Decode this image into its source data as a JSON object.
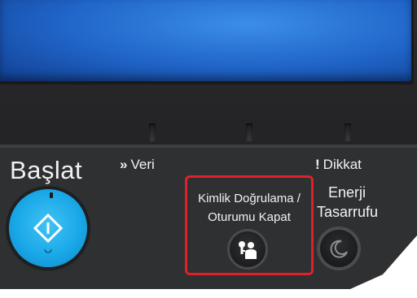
{
  "panel": {
    "start_label": "Başlat",
    "data_indicator": {
      "prefix": "»",
      "label": "Veri"
    },
    "attention_indicator": {
      "prefix": "!",
      "label": "Dikkat"
    },
    "auth_button": {
      "line1": "Kimlik Doğrulama /",
      "line2": "Oturumu Kapat",
      "icon": "users-key-icon"
    },
    "energy_button": {
      "line1": "Enerji",
      "line2": "Tasarrufu",
      "icon": "crescent-moon-icon"
    },
    "start_icon": "diamond-start-icon",
    "highlight_color": "#e0202a",
    "start_color": "#1aa8e8",
    "screen_color": "#1f63c6"
  }
}
